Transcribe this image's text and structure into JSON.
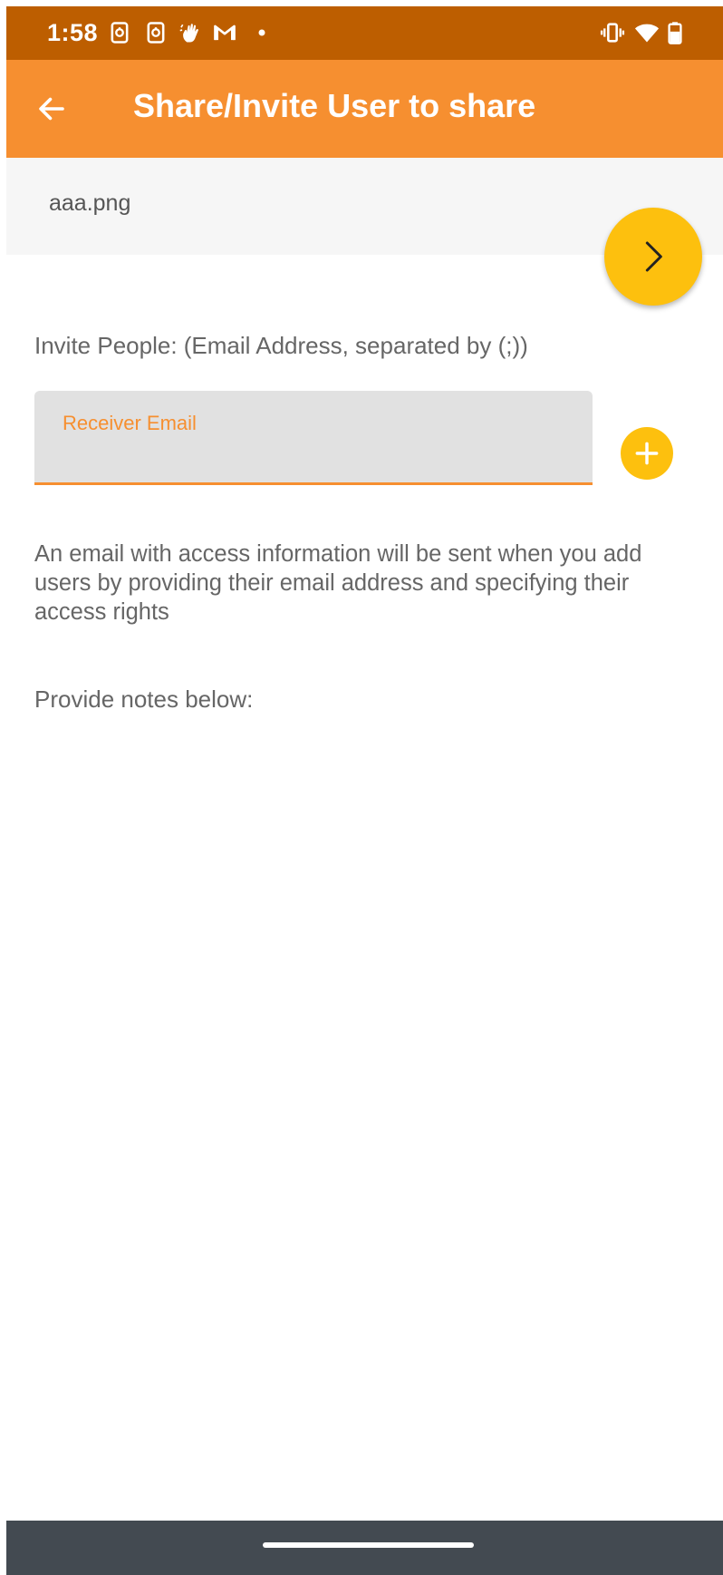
{
  "status_bar": {
    "time": "1:58",
    "left_icons": [
      "screenshot-icon",
      "screenshot-icon",
      "hand-icon",
      "gmail-icon",
      "dot-icon"
    ],
    "right_icons": [
      "vibrate-icon",
      "wifi-icon",
      "battery-icon"
    ],
    "background_color": "#bd5e00"
  },
  "app_bar": {
    "title": "Share/Invite User to share",
    "back_icon": "back-arrow-icon",
    "background_color": "#f68f30"
  },
  "file": {
    "name": "aaa.png"
  },
  "next_button": {
    "icon": "chevron-right-icon",
    "color": "#fdc00e"
  },
  "invite": {
    "label": "Invite People: (Email Address, separated by (;))",
    "field_label": "Receiver Email",
    "field_value": "",
    "add_icon": "plus-icon",
    "accent_color": "#f68f30"
  },
  "info_text": "An email with access information will be sent when you add users by providing their email address and specifying their access rights",
  "notes_label": "Provide notes below:",
  "nav_bar": {
    "background_color": "#434a51"
  }
}
